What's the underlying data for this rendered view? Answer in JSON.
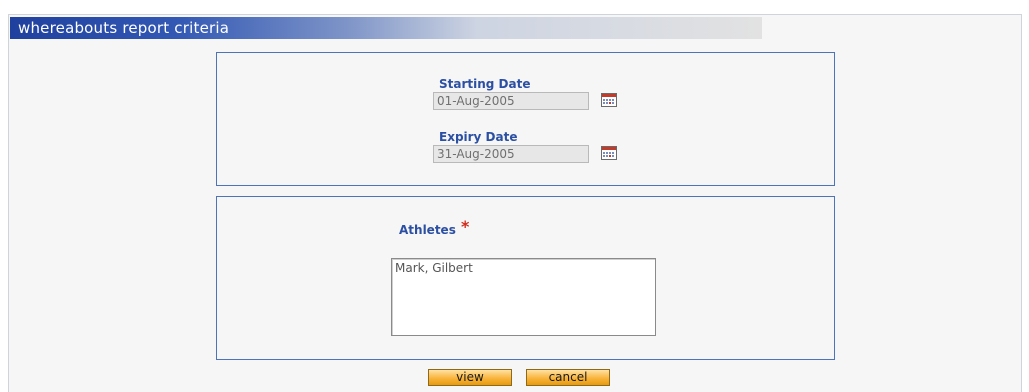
{
  "header": {
    "title": "whereabouts report criteria"
  },
  "dates": {
    "starting_label": "Starting Date",
    "starting_value": "01-Aug-2005",
    "expiry_label": "Expiry Date",
    "expiry_value": "31-Aug-2005",
    "calendar_icon": "calendar-icon"
  },
  "athletes": {
    "label": "Athletes",
    "required_mark": "*",
    "items": [
      "Mark, Gilbert"
    ]
  },
  "buttons": {
    "view": "view",
    "cancel": "cancel"
  },
  "colors": {
    "title_bar_start": "#20409e",
    "label_blue": "#2b4fa3",
    "panel_border": "#4e73b9",
    "required_red": "#d02b1b",
    "button_orange": "#f9b43c"
  }
}
